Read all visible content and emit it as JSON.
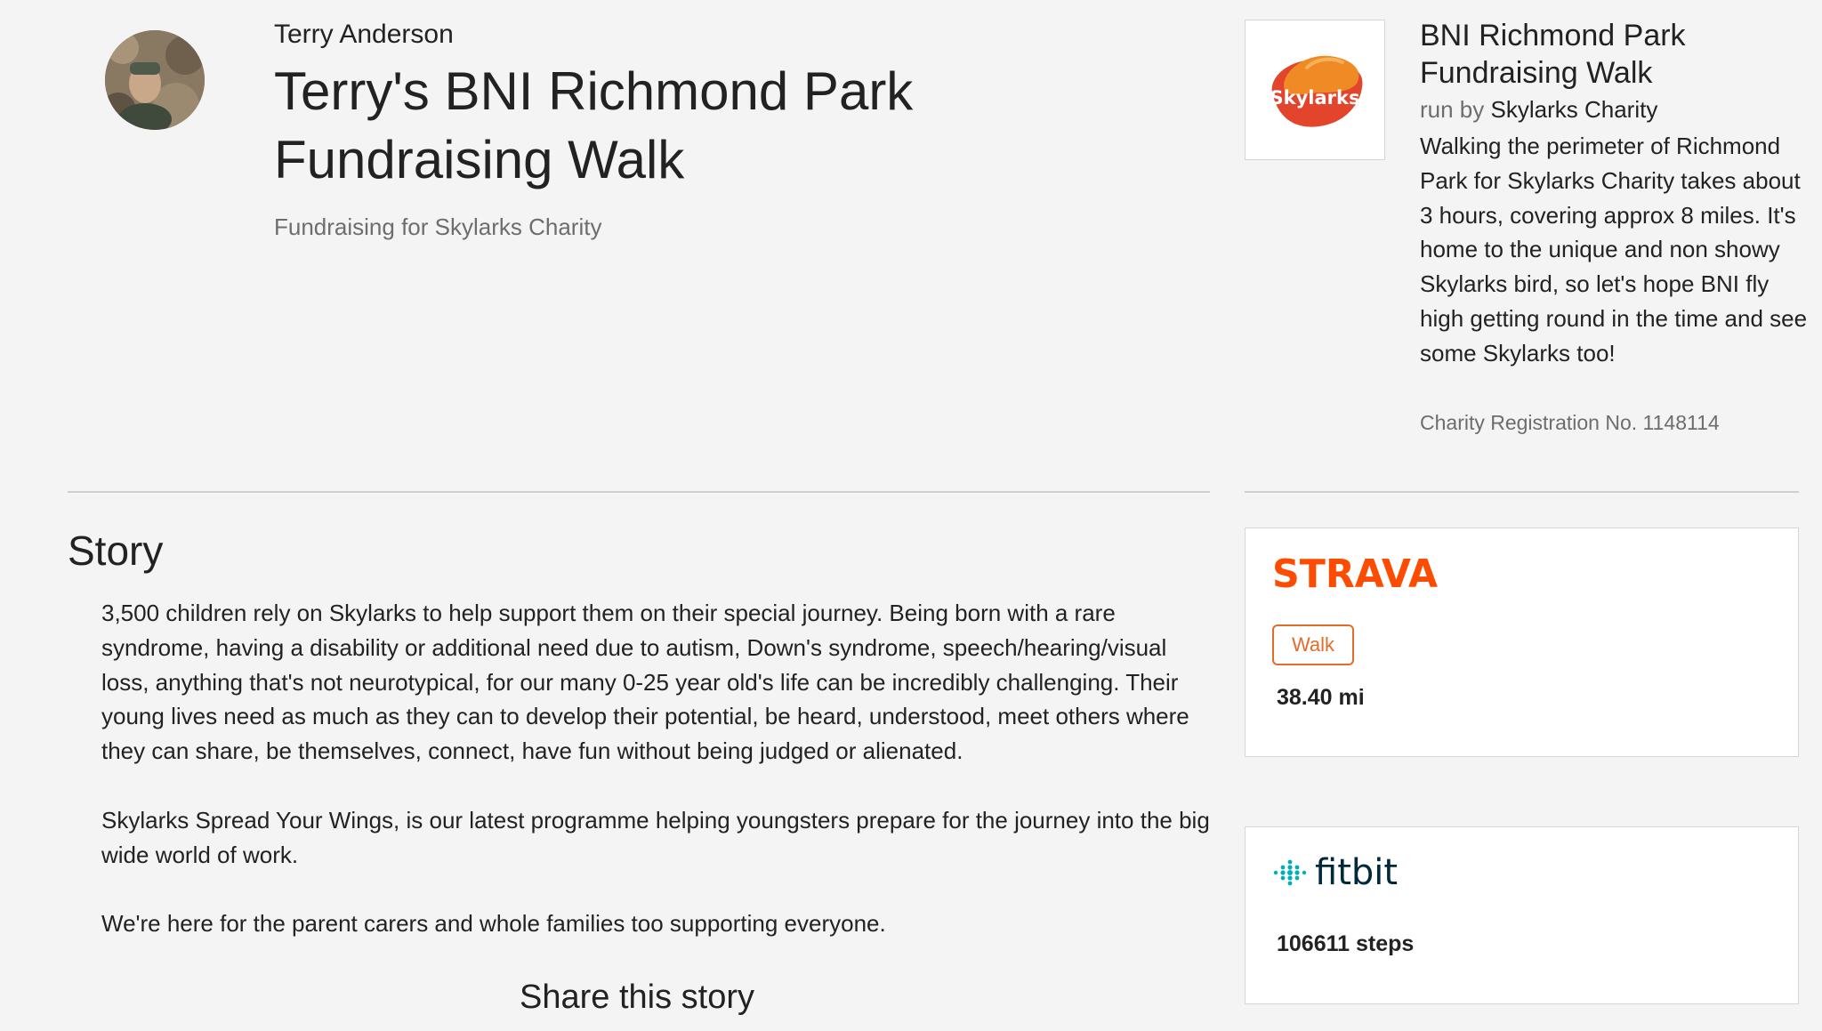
{
  "fundraiser": {
    "owner_name": "Terry Anderson",
    "title": "Terry's BNI Richmond Park Fundraising Walk",
    "fundraising_for": "Fundraising for Skylarks Charity"
  },
  "event": {
    "logo_text": "Skylarks",
    "title": "BNI Richmond Park Fundraising Walk",
    "run_by_label": "run by",
    "charity_name": "Skylarks Charity",
    "description": "Walking the perimeter of Richmond Park for Skylarks Charity takes about 3 hours, covering approx 8 miles. It's home to the unique and non showy Skylarks bird, so let's hope BNI fly high getting round in the time and see some Skylarks too!",
    "registration": "Charity Registration No. 1148114"
  },
  "story": {
    "heading": "Story",
    "paragraphs": [
      "3,500 children rely on Skylarks to help support them on their special journey. Being born with a rare syndrome, having a disability or additional need due to autism, Down's syndrome, speech/hearing/visual loss, anything that's not neurotypical, for our many 0-25 year old's life can be incredibly challenging. Their young lives need as much as they can to develop their potential, be heard, understood, meet others where they can share, be themselves, connect, have fun without being judged or alienated.",
      "Skylarks Spread Your Wings, is our latest programme helping youngsters prepare for the journey into the big wide world of work.",
      "We're here for the parent carers and whole families too supporting everyone."
    ],
    "share_heading": "Share this story"
  },
  "activity": {
    "strava": {
      "logo_text": "STRAVA",
      "activity_type": "Walk",
      "distance": "38.40 mi"
    },
    "fitbit": {
      "logo_text": "fitbit",
      "steps": "106611 steps"
    }
  },
  "colors": {
    "background": "#f4f4f4",
    "strava_orange": "#fc4c02",
    "badge_orange": "#e36c2a",
    "fitbit_teal": "#00b0b9",
    "fitbit_text": "#002a3a",
    "skylarks_orange": "#f08a24",
    "skylarks_red": "#e2452b"
  }
}
